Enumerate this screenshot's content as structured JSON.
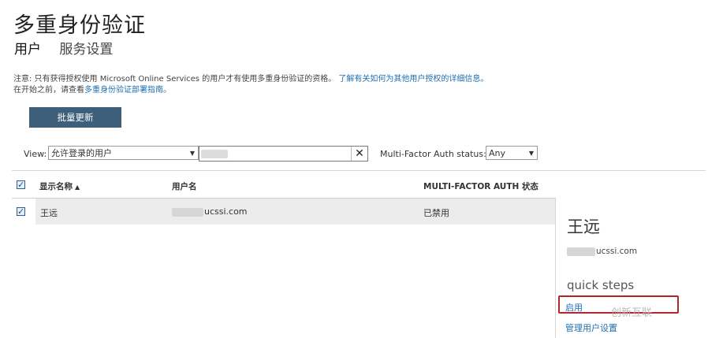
{
  "page": {
    "title": "多重身份验证",
    "tabs": [
      {
        "label": "用户",
        "active": true
      },
      {
        "label": "服务设置",
        "active": false
      }
    ]
  },
  "notice": {
    "line1_prefix": "注意: 只有获得授权使用 Microsoft Online Services 的用户才有使用多重身份验证的资格。",
    "line1_link": "了解有关如何为其他用户授权的详细信息。",
    "line2_prefix": "在开始之前，请查看",
    "line2_link": "多重身份验证部署指南。"
  },
  "toolbar": {
    "bulk_update_label": "批量更新"
  },
  "filter": {
    "view_label": "View:",
    "view_value": "允许登录的用户",
    "search_value": "",
    "status_label": "Multi-Factor Auth status:",
    "status_value": "Any"
  },
  "table": {
    "columns": [
      {
        "label": "显示名称",
        "sorted": "ascending"
      },
      {
        "label": "用户名"
      },
      {
        "label": "MULTI-FACTOR AUTH 状态"
      }
    ],
    "rows": [
      {
        "display_name": "王远",
        "username_suffix": "ucssi.com",
        "status": "已禁用",
        "selected": true
      }
    ]
  },
  "detail_panel": {
    "name": "王远",
    "email_suffix": "ucssi.com",
    "section_title": "quick steps",
    "actions": {
      "enable": "启用",
      "manage": "管理用户设置"
    }
  },
  "watermark": {
    "text": "创新互联"
  },
  "colors": {
    "accent_button": "#3d5f7a",
    "link": "#1f6fb2",
    "highlight_box": "#b5262a",
    "row_selected": "#ececec"
  }
}
